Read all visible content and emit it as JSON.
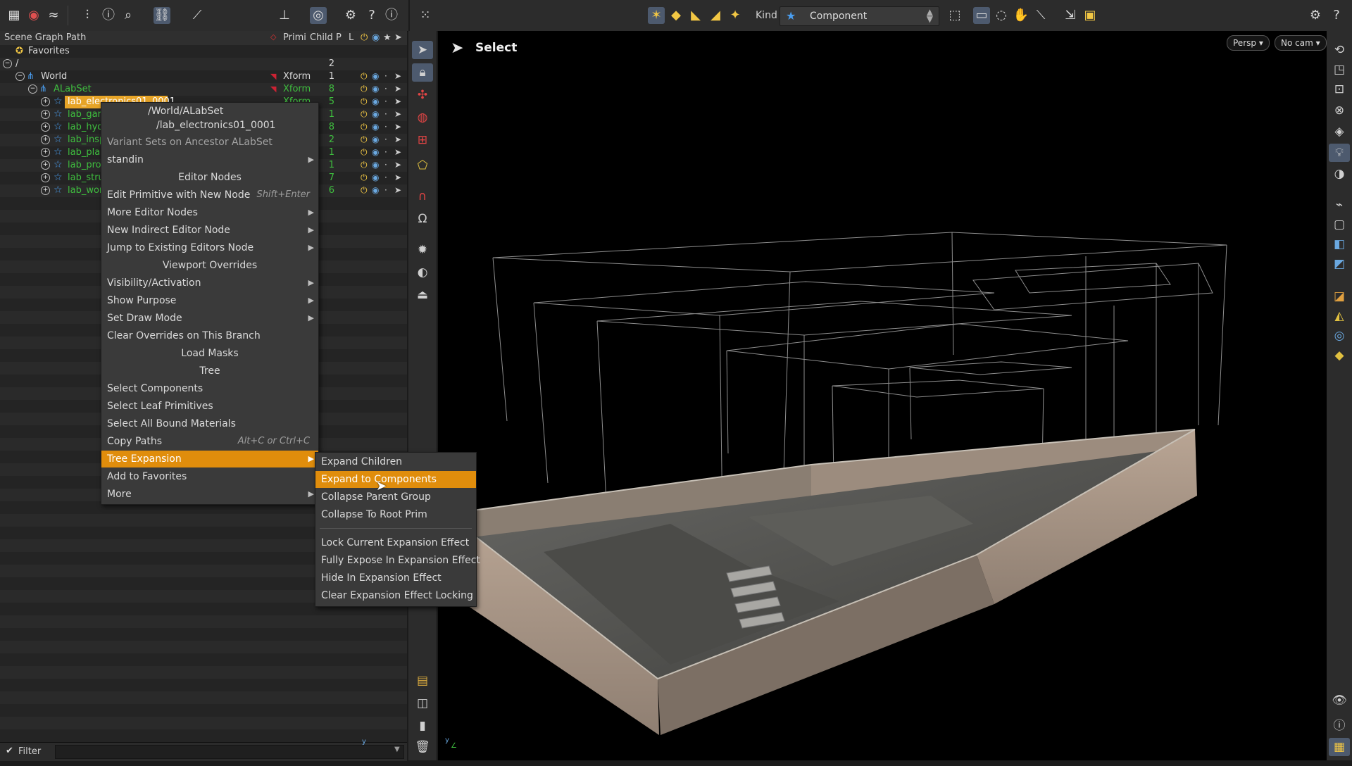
{
  "toolbar": {
    "kind_label": "Kind",
    "kind_value": "Component"
  },
  "tree": {
    "headers": {
      "path": "Scene Graph Path",
      "prim": "Primi",
      "child": "Child",
      "p": "P",
      "l": "L"
    },
    "favorites": "Favorites",
    "rows": [
      {
        "name": "/",
        "type": "",
        "children": "2"
      },
      {
        "name": "World",
        "type": "Xform",
        "children": "1"
      },
      {
        "name": "ALabSet",
        "type": "Xform",
        "children": "8"
      },
      {
        "name": "lab_electronics01_0001",
        "type": "Xform",
        "children": "5"
      },
      {
        "name": "lab_gar",
        "type": "Xform",
        "children": "1"
      },
      {
        "name": "lab_hyd",
        "type": "Xform",
        "children": "8"
      },
      {
        "name": "lab_insp",
        "type": "Xform",
        "children": "2"
      },
      {
        "name": "lab_plar",
        "type": "Xform",
        "children": "1"
      },
      {
        "name": "lab_pro",
        "type": "Xform",
        "children": "1"
      },
      {
        "name": "lab_stru",
        "type": "Xform",
        "children": "7"
      },
      {
        "name": "lab_wor",
        "type": "Xform",
        "children": "6"
      }
    ],
    "filter_label": "Filter"
  },
  "viewport": {
    "title": "Select",
    "persp": "Persp",
    "cam": "No cam"
  },
  "context_menu": {
    "path_line1": "/World/ALabSet",
    "path_line2": "/lab_electronics01_0001",
    "variant_header": "Variant Sets on Ancestor ALabSet",
    "standin": "standin",
    "editor_nodes_header": "Editor Nodes",
    "edit_primitive": "Edit Primitive with New Node",
    "edit_primitive_shortcut": "Shift+Enter",
    "more_editor_nodes": "More Editor Nodes",
    "new_indirect": "New Indirect Editor Node",
    "jump_existing": "Jump to Existing Editors Node",
    "viewport_overrides_header": "Viewport Overrides",
    "visibility": "Visibility/Activation",
    "show_purpose": "Show Purpose",
    "set_draw_mode": "Set Draw Mode",
    "clear_overrides": "Clear Overrides on This Branch",
    "load_masks_header": "Load Masks",
    "tree_header": "Tree",
    "select_components": "Select Components",
    "select_leaf": "Select Leaf Primitives",
    "select_materials": "Select All Bound Materials",
    "copy_paths": "Copy Paths",
    "copy_paths_shortcut": "Alt+C or Ctrl+C",
    "tree_expansion": "Tree Expansion",
    "add_favorites": "Add to Favorites",
    "more": "More"
  },
  "submenu": {
    "expand_children": "Expand Children",
    "expand_components": "Expand to Components",
    "collapse_parent": "Collapse Parent Group",
    "collapse_root": "Collapse To Root Prim",
    "lock_current": "Lock Current Expansion Effect",
    "fully_expose": "Fully Expose In Expansion Effect",
    "hide_in": "Hide In Expansion Effect",
    "clear_locking": "Clear Expansion Effect Locking"
  },
  "colors": {
    "menu_highlight": "#e08d0c",
    "selection": "#e7a427",
    "component_green": "#3fbf3f",
    "component_icon": "#4a9ef0"
  }
}
